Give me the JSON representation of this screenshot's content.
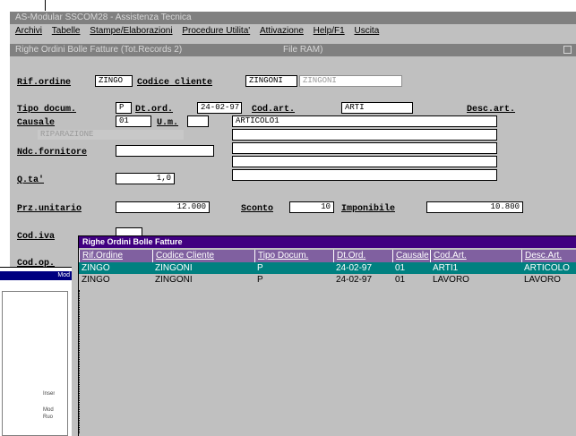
{
  "app": {
    "title": "AS-Modular SSCOM28 - Assistenza Tecnica",
    "menu": [
      "Archivi",
      "Tabelle",
      "Stampe/Elaborazioni",
      "Procedure Utilita'",
      "Attivazione",
      "Help/F1",
      "Uscita"
    ]
  },
  "form": {
    "title": "Righe Ordini Bolle Fatture (Tot.Records 2)",
    "file_label": "File RAM)",
    "rif_ordine": {
      "label": "Rif.ordine",
      "value": "ZINGO"
    },
    "codice_cliente": {
      "label": "Codice cliente",
      "value": "ZINGONI",
      "desc": "ZINGONI"
    },
    "tipo_docum": {
      "label": "Tipo docum.",
      "value": "P"
    },
    "dt_ord": {
      "label": "Dt.ord.",
      "value": "24-02-97"
    },
    "cod_art": {
      "label": "Cod.art.",
      "value": "ARTI"
    },
    "desc_art": {
      "label": "Desc.art.",
      "lines": [
        "ARTICOLO1",
        "",
        "",
        "",
        ""
      ]
    },
    "causale": {
      "label": "Causale",
      "value": "01",
      "desc": "RIPARAZIONE"
    },
    "um": {
      "label": "U.m.",
      "value": ""
    },
    "ndc_fornitore": {
      "label": "Ndc.fornitore",
      "value": ""
    },
    "qta": {
      "label": "Q.ta'",
      "value": "1,0"
    },
    "prz_unitario": {
      "label": "Prz.unitario",
      "value": "12.000"
    },
    "sconto": {
      "label": "Sconto",
      "value": "10"
    },
    "imponibile": {
      "label": "Imponibile",
      "value": "10.800"
    },
    "cod_iva": {
      "label": "Cod.iva",
      "value": ""
    },
    "cod_op": {
      "label": "Cod.op.",
      "value": ""
    }
  },
  "list": {
    "title": "Righe Ordini Bolle Fatture",
    "columns": [
      "Rif.Ordine",
      "Codice Cliente",
      "Tipo Docum.",
      "Dt.Ord.",
      "Causale",
      "Cod.Art.",
      "Desc.Art."
    ],
    "rows": [
      [
        "ZINGO",
        "ZINGONI",
        "P",
        "24-02-97",
        "01",
        "ARTI1",
        "ARTICOLO"
      ],
      [
        "ZINGO",
        "ZINGONI",
        "P",
        "24-02-97",
        "01",
        "LAVORO",
        "LAVORO"
      ]
    ]
  },
  "left_window": {
    "title": "Mod",
    "cells": [
      "Inser",
      "Mod",
      "Ruo"
    ]
  }
}
